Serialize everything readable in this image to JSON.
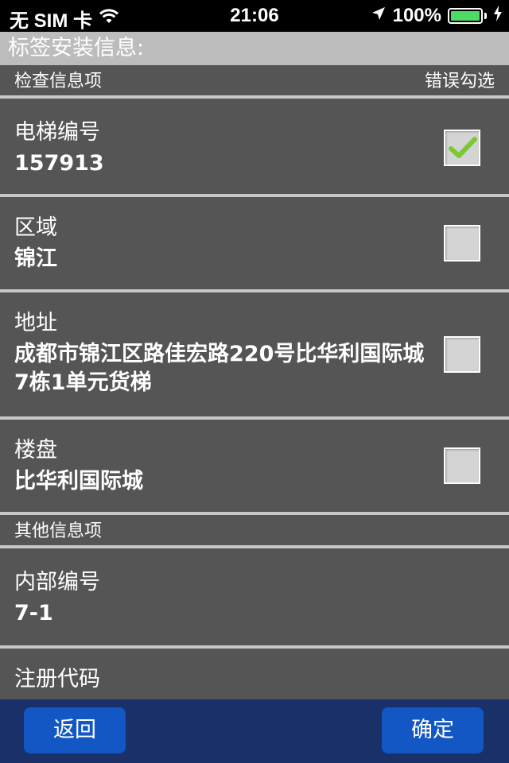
{
  "status_bar": {
    "carrier": "无 SIM 卡",
    "time": "21:06",
    "battery_percent": "100%",
    "battery_level": 1.0,
    "icons": [
      "wifi-icon",
      "location-arrow-icon",
      "battery-icon",
      "charging-bolt-icon"
    ]
  },
  "title": "标签安装信息:",
  "inspection_section": {
    "header_left": "检查信息项",
    "header_right": "错误勾选"
  },
  "inspection_items": [
    {
      "label": "电梯编号",
      "value": "157913",
      "checked": true
    },
    {
      "label": "区域",
      "value": "锦江",
      "checked": false
    },
    {
      "label": "地址",
      "value": "成都市锦江区路佳宏路220号比华利国际城7栋1单元货梯",
      "checked": false
    },
    {
      "label": "楼盘",
      "value": "比华利国际城",
      "checked": false
    }
  ],
  "other_section": {
    "header_left": "其他信息项"
  },
  "other_items": [
    {
      "label": "内部编号",
      "value": "7-1"
    },
    {
      "label": "注册代码",
      "value": ""
    }
  ],
  "buttons": {
    "back": "返回",
    "confirm": "确定"
  },
  "colors": {
    "background": "#555555",
    "title_bar": "#bcbcbc",
    "bottom_bar": "#1a3068",
    "button": "#1257c4",
    "check_mark": "#7cc832"
  }
}
